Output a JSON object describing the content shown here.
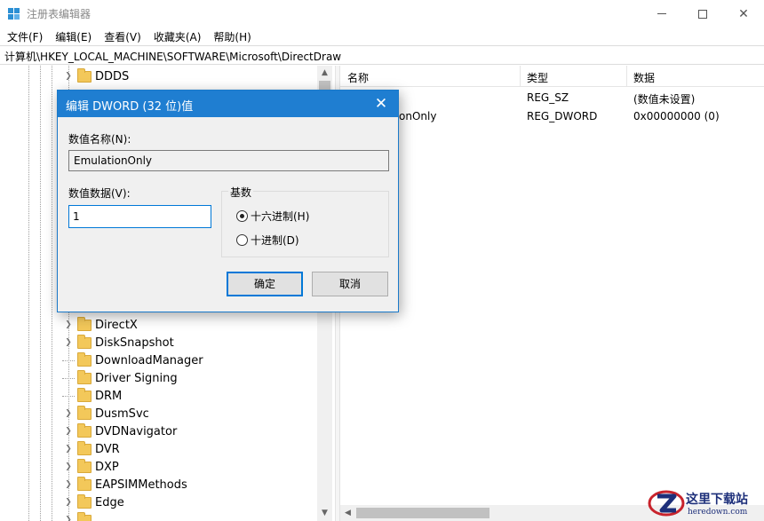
{
  "window": {
    "title": "注册表编辑器",
    "minimize_icon": "minimize-icon",
    "maximize_icon": "maximize-icon",
    "close_glyph": "✕"
  },
  "menu": [
    "文件(F)",
    "编辑(E)",
    "查看(V)",
    "收藏夹(A)",
    "帮助(H)"
  ],
  "address": "计算机\\HKEY_LOCAL_MACHINE\\SOFTWARE\\Microsoft\\DirectDraw",
  "tree": {
    "items": [
      {
        "label": "DDDS",
        "expandable": true
      },
      {
        "label": "DirectX",
        "expandable": true
      },
      {
        "label": "DiskSnapshot",
        "expandable": true
      },
      {
        "label": "DownloadManager",
        "expandable": false
      },
      {
        "label": "Driver Signing",
        "expandable": false
      },
      {
        "label": "DRM",
        "expandable": false
      },
      {
        "label": "DusmSvc",
        "expandable": true
      },
      {
        "label": "DVDNavigator",
        "expandable": true
      },
      {
        "label": "DVR",
        "expandable": true
      },
      {
        "label": "DXP",
        "expandable": true
      },
      {
        "label": "EAPSIMMethods",
        "expandable": true
      },
      {
        "label": "Edge",
        "expandable": true
      }
    ]
  },
  "list": {
    "columns": [
      "名称",
      "类型",
      "数据"
    ],
    "rows": [
      {
        "name": "",
        "type": "REG_SZ",
        "data": "(数值未设置)"
      },
      {
        "name": "onOnly",
        "type": "REG_DWORD",
        "data": "0x00000000 (0)"
      }
    ]
  },
  "dialog": {
    "title": "编辑 DWORD (32 位)值",
    "close_glyph": "✕",
    "value_name_label": "数值名称(N):",
    "value_name": "EmulationOnly",
    "value_data_label": "数值数据(V):",
    "value_data": "1",
    "base_label": "基数",
    "radio_hex": "十六进制(H)",
    "radio_dec": "十进制(D)",
    "selected_base": "hex",
    "ok": "确定",
    "cancel": "取消"
  },
  "watermark": {
    "text": "这里下载站",
    "url": "heredown.com"
  },
  "colors": {
    "dialog_title_bg": "#1f7ed1",
    "folder": "#f3c85a",
    "accent": "#0078d7"
  }
}
